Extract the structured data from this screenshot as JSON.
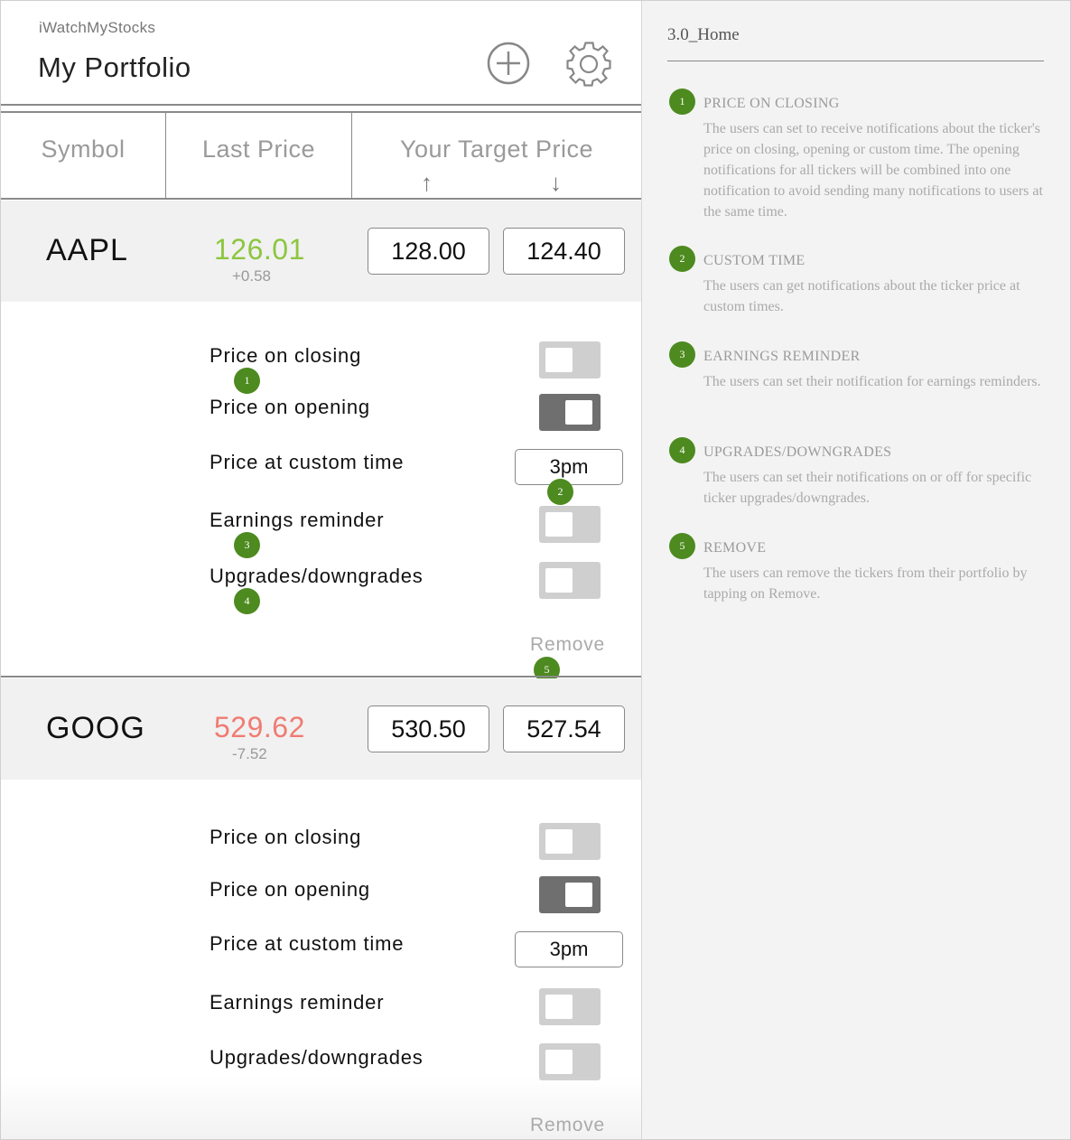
{
  "app": {
    "name": "iWatchMyStocks",
    "title": "My Portfolio",
    "add_icon": "plus-circle-icon",
    "settings_icon": "gear-icon"
  },
  "columns": {
    "symbol": "Symbol",
    "last_price": "Last Price",
    "target_price": "Your Target Price",
    "up_arrow": "↑",
    "down_arrow": "↓"
  },
  "tickers": [
    {
      "symbol": "AAPL",
      "price": "126.01",
      "change": "+0.58",
      "price_color": "#8cc63f",
      "target_up": "128.00",
      "target_down": "124.40",
      "options": [
        {
          "label": "Price on closing",
          "state": "off"
        },
        {
          "label": "Price on opening",
          "state": "on"
        },
        {
          "label": "Price at custom time",
          "value": "3pm"
        },
        {
          "label": "Earnings reminder",
          "state": "off"
        },
        {
          "label": "Upgrades/downgrades",
          "state": "off"
        }
      ],
      "remove_label": "Remove"
    },
    {
      "symbol": "GOOG",
      "price": "529.62",
      "change": "-7.52",
      "price_color": "#f07c73",
      "target_up": "530.50",
      "target_down": "527.54",
      "options": [
        {
          "label": "Price on closing",
          "state": "off"
        },
        {
          "label": "Price on opening",
          "state": "on"
        },
        {
          "label": "Price at custom time",
          "value": "3pm"
        },
        {
          "label": "Earnings reminder",
          "state": "off"
        },
        {
          "label": "Upgrades/downgrades",
          "state": "off"
        }
      ],
      "remove_label": "Remove"
    }
  ],
  "badges": [
    "1",
    "2",
    "3",
    "4",
    "5"
  ],
  "badge_color": "#4d8a1f",
  "notes": {
    "title": "3.0_Home",
    "items": [
      {
        "num": "1",
        "heading": "PRICE ON CLOSING",
        "body": "The users can set to receive notifications about the ticker's price on closing, opening or custom time. The opening notifications for all tickers will be combined into one notification to avoid sending many notifications to users at the same time."
      },
      {
        "num": "2",
        "heading": "CUSTOM TIME",
        "body": "The users can get notifications about the ticker price at custom times."
      },
      {
        "num": "3",
        "heading": "EARNINGS REMINDER",
        "body": "The users can set their notification for earnings reminders."
      },
      {
        "num": "4",
        "heading": "UPGRADES/DOWNGRADES",
        "body": "The users can set their notifications on or off for specific ticker upgrades/downgrades."
      },
      {
        "num": "5",
        "heading": "REMOVE",
        "body": "The users can remove the tickers from their portfolio by tapping on Remove."
      }
    ]
  }
}
